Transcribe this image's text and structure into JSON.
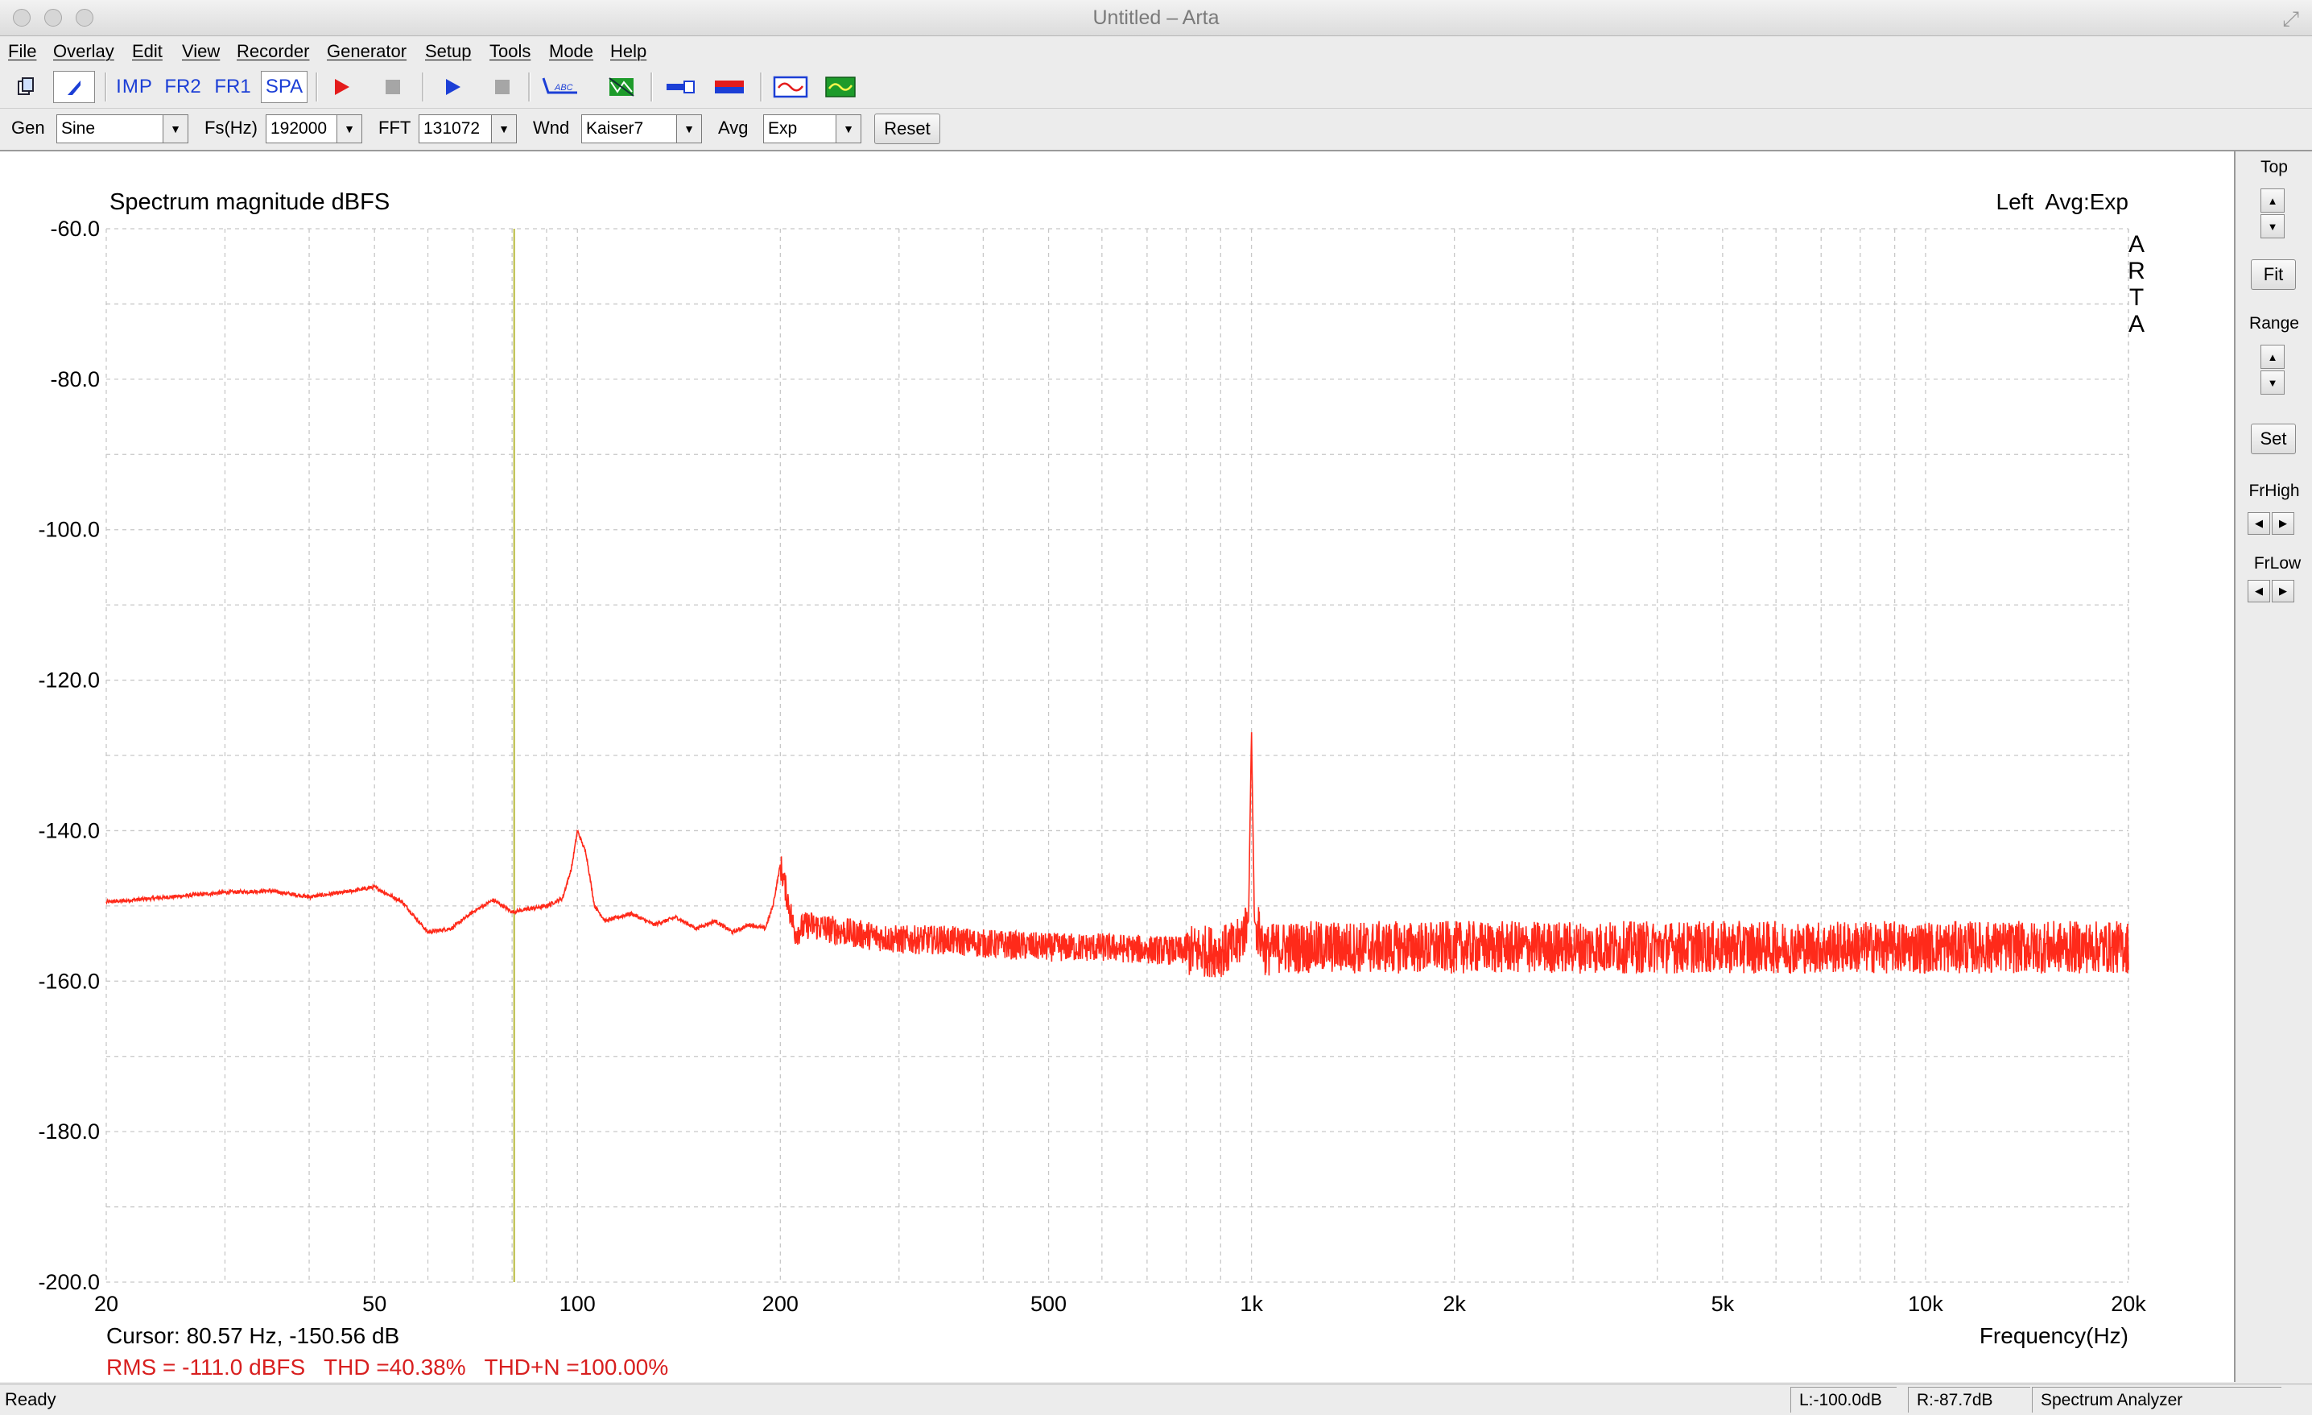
{
  "window": {
    "title": "Untitled – Arta"
  },
  "menu": [
    "File",
    "Overlay",
    "Edit",
    "View",
    "Recorder",
    "Generator",
    "Setup",
    "Tools",
    "Mode",
    "Help"
  ],
  "toolbar": {
    "imp": "IMP",
    "fr2": "FR2",
    "fr1": "FR1",
    "spa": "SPA",
    "abc": "ABC",
    "icons": [
      "new-file-icon",
      "cursor-mode-icon",
      "impulse-mode-icon",
      "fr2-mode-icon",
      "fr1-mode-icon",
      "spectrum-mode-icon",
      "record-icon",
      "stop-icon",
      "play-icon",
      "stop-icon",
      "abc-overlay-icon",
      "spectrum-display-icon",
      "connector-icon",
      "color-bar-icon",
      "signal-icon",
      "waveform-icon"
    ]
  },
  "controls": {
    "gen_label": "Gen",
    "gen_value": "Sine",
    "fs_label": "Fs(Hz)",
    "fs_value": "192000",
    "fft_label": "FFT",
    "fft_value": "131072",
    "wnd_label": "Wnd",
    "wnd_value": "Kaiser7",
    "avg_label": "Avg",
    "avg_value": "Exp",
    "reset_label": "Reset"
  },
  "side": {
    "top_label": "Top",
    "fit_label": "Fit",
    "range_label": "Range",
    "set_label": "Set",
    "frhigh_label": "FrHigh",
    "frlow_label": "FrLow"
  },
  "plot": {
    "cursor_text": "Cursor: 80.57 Hz, -150.56 dB",
    "stats_text": "RMS = -111.0 dBFS   THD =40.38%   THD+N =100.00%",
    "channel_text": "Left  Avg:Exp",
    "brand": [
      "A",
      "R",
      "T",
      "A"
    ]
  },
  "status": {
    "ready": "Ready",
    "left_level": "L:-100.0dB",
    "right_level": "R:-87.7dB",
    "mode": "Spectrum Analyzer"
  },
  "colors": {
    "trace": "#ff2a1a",
    "cursor": "#b6b83a",
    "grid": "#c8c8c8",
    "stats": "#d81f1f"
  },
  "chart_data": {
    "type": "line",
    "title": "Spectrum magnitude dBFS",
    "xlabel": "Frequency(Hz)",
    "ylabel": "",
    "xscale": "log",
    "xlim": [
      20,
      20000
    ],
    "ylim": [
      -200,
      -60
    ],
    "x_ticks": [
      20,
      50,
      100,
      200,
      500,
      1000,
      2000,
      5000,
      10000,
      20000
    ],
    "x_tick_labels": [
      "20",
      "50",
      "100",
      "200",
      "500",
      "1k",
      "2k",
      "5k",
      "10k",
      "20k"
    ],
    "y_ticks": [
      -60,
      -80,
      -100,
      -120,
      -140,
      -160,
      -180,
      -200
    ],
    "y_tick_labels": [
      "-60.0",
      "-80.0",
      "-100.0",
      "-120.0",
      "-140.0",
      "-160.0",
      "-180.0",
      "-200.0"
    ],
    "grid": true,
    "cursor_x": 80.57,
    "series": [
      {
        "x": [
          20,
          25,
          30,
          35,
          40,
          45,
          50,
          55,
          60,
          65,
          70,
          75,
          80,
          85,
          90,
          95,
          98,
          100,
          103,
          106,
          110,
          120,
          130,
          140,
          150,
          160,
          170,
          180,
          190,
          195,
          200,
          205,
          210,
          220,
          250,
          300,
          350,
          400,
          500,
          600,
          700,
          800,
          900,
          950,
          990,
          1000,
          1010,
          1050,
          1100,
          1200,
          1500,
          2000,
          3000,
          5000,
          7000,
          10000,
          15000,
          20000
        ],
        "y": [
          -149.5,
          -148.8,
          -148.2,
          -148.0,
          -148.8,
          -148.2,
          -147.5,
          -149.5,
          -153.5,
          -153.0,
          -150.8,
          -149.2,
          -150.8,
          -150.4,
          -150.0,
          -149.0,
          -145.0,
          -140.0,
          -143.0,
          -150.0,
          -152.0,
          -151.0,
          -152.5,
          -151.5,
          -153.0,
          -152.0,
          -153.5,
          -152.5,
          -153.0,
          -150.0,
          -144.5,
          -149.0,
          -153.5,
          -152.5,
          -153.5,
          -154.5,
          -154.5,
          -155.0,
          -155.5,
          -155.5,
          -155.8,
          -156.0,
          -156.0,
          -155.5,
          -152.0,
          -126.5,
          -152.0,
          -156.0,
          -155.5,
          -155.5,
          -155.5,
          -155.5,
          -155.5,
          -155.5,
          -155.5,
          -155.5,
          -155.5,
          -155.5
        ]
      }
    ],
    "noise_spread_db": 3.5
  }
}
